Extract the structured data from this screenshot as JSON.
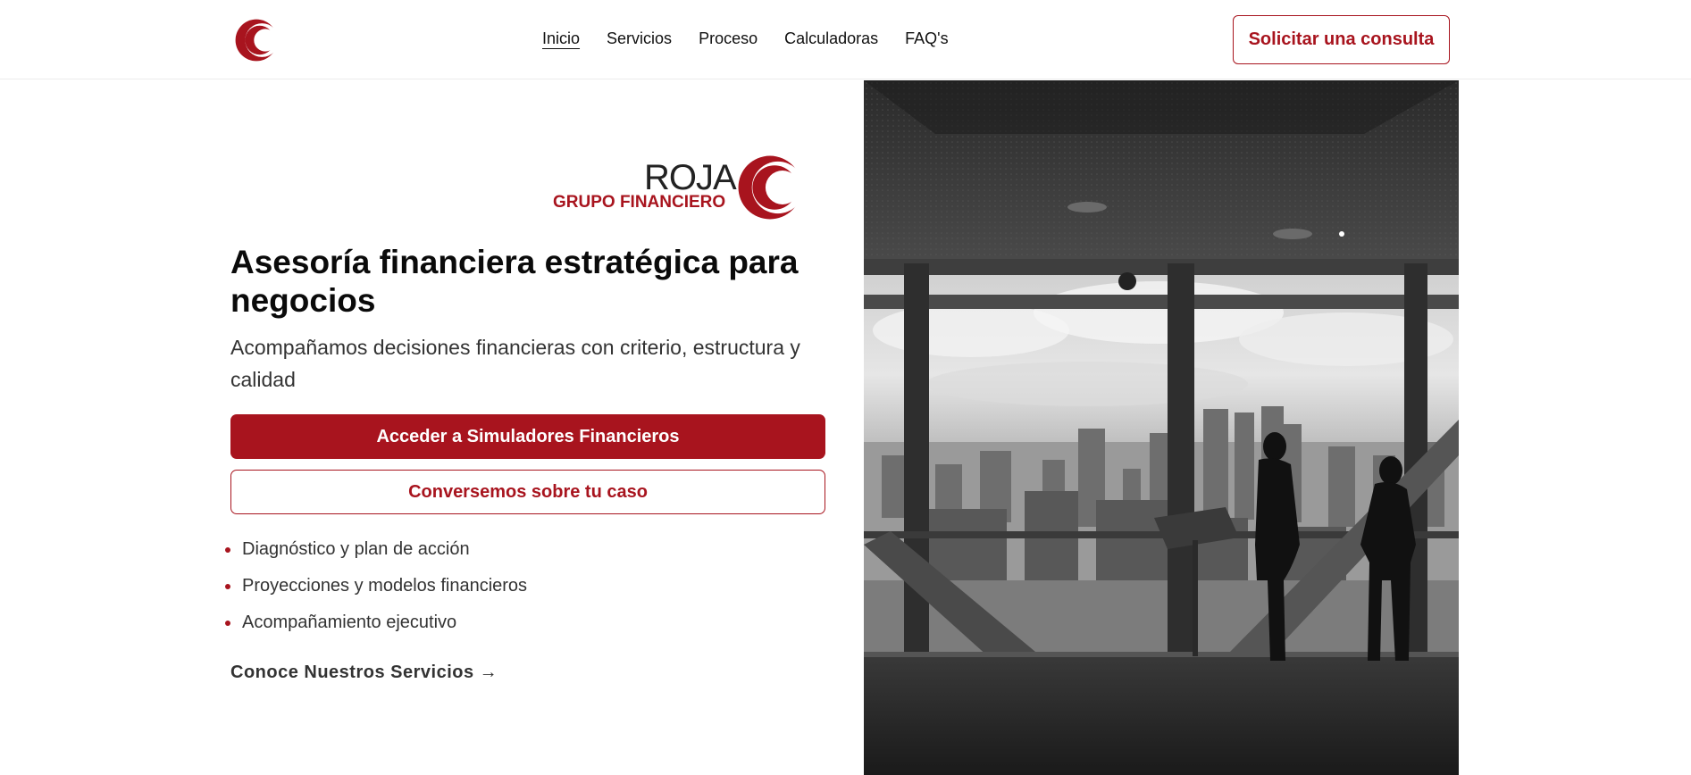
{
  "header": {
    "logo_icon": "rg-crescent-logo",
    "nav": [
      {
        "label": "Inicio",
        "active": true
      },
      {
        "label": "Servicios",
        "active": false
      },
      {
        "label": "Proceso",
        "active": false
      },
      {
        "label": "Calculadoras",
        "active": false
      },
      {
        "label": "FAQ's",
        "active": false
      }
    ],
    "cta_label": "Solicitar una consulta"
  },
  "brand": {
    "name": "ROJA",
    "subtitle": "GRUPO FINANCIERO"
  },
  "hero": {
    "title": "Asesoría financiera estratégica para negocios",
    "subtitle": "Acompañamos decisiones financieras con criterio, estructura y calidad",
    "primary_button": "Acceder a Simuladores Financieros",
    "secondary_button": "Conversemos sobre tu caso",
    "bullets": [
      "Diagnóstico y plan de acción",
      "Proyecciones y modelos financieros",
      "Acompañamiento ejecutivo"
    ],
    "services_link": "Conoce Nuestros Servicios →"
  },
  "image": {
    "subject": "office-skyline-silhouettes-photo"
  },
  "colors": {
    "brand_red": "#a8141e",
    "text_dark": "#111111",
    "text_muted": "#333333"
  }
}
